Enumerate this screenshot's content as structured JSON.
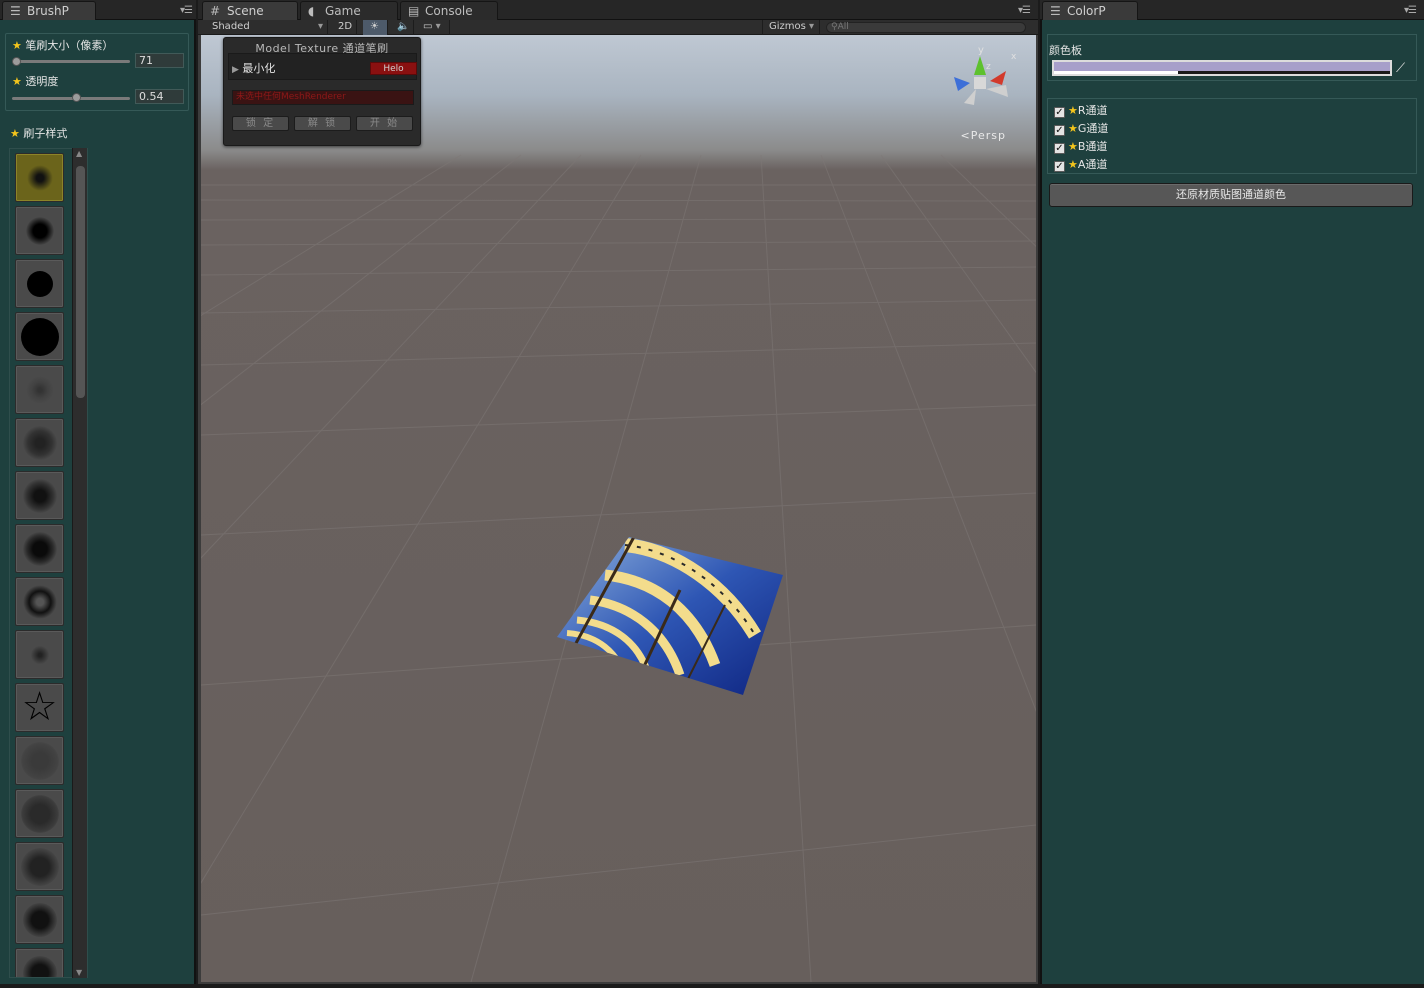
{
  "brushp": {
    "tab_title": "BrushP",
    "brush_size_label": "笔刷大小（像素）",
    "brush_size_value": "71",
    "brush_size_fraction": 0.03,
    "opacity_label": "透明度",
    "opacity_value": "0.54",
    "opacity_fraction": 0.54,
    "brush_style_label": "刷子样式",
    "brushes": [
      "soft-blur",
      "soft-small",
      "hard-medium",
      "hard-large",
      "spatter-1",
      "spatter-2",
      "spatter-3",
      "spatter-4",
      "flower",
      "sparkle",
      "star-outline",
      "texture-1",
      "texture-2",
      "texture-3",
      "texture-4",
      "texture-5"
    ],
    "selected_brush": 0
  },
  "scene": {
    "tabs": [
      "Scene",
      "Game",
      "Console"
    ],
    "shading_mode": "Shaded",
    "mode_2d": "2D",
    "gizmos_label": "Gizmos",
    "search_placeholder": "All",
    "persp_label": "Persp",
    "gizmo_axes": {
      "x": "x",
      "y": "y",
      "z": "z"
    },
    "brush_window": {
      "title": "Model Texture 通道笔刷",
      "minimize_label": "最小化",
      "hello_button": "Helo",
      "warning": "未选中任何MeshRenderer",
      "lock_button": "锁 定",
      "unlock_button": "解 锁",
      "start_button": "开 始"
    }
  },
  "colorp": {
    "tab_title": "ColorP",
    "palette_label": "颜色板",
    "color": "#a79fca",
    "alpha_fraction": 0.37,
    "channels": [
      {
        "label": "R通道",
        "checked": true
      },
      {
        "label": "G通道",
        "checked": true
      },
      {
        "label": "B通道",
        "checked": true
      },
      {
        "label": "A通道",
        "checked": true
      }
    ],
    "restore_button": "还原材质贴图通道颜色"
  },
  "colors": {
    "panel_bg": "#1e403e",
    "star": "#f4c51c",
    "selected_brush": "#6b641b",
    "hello_button": "#8a1010"
  }
}
